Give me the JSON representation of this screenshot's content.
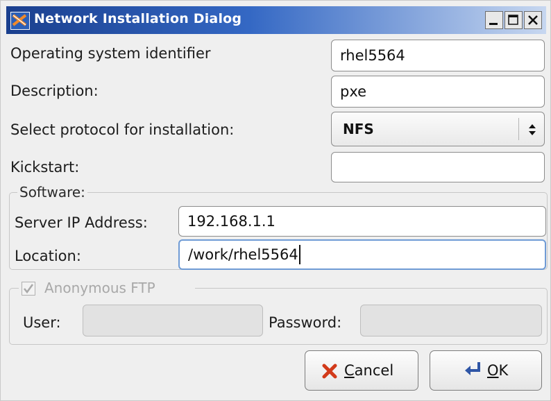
{
  "window": {
    "title": "Network Installation Dialog",
    "title_icon": "network-install-icon",
    "controls": [
      "minimize-icon",
      "maximize-icon",
      "close-icon"
    ]
  },
  "form": {
    "os_identifier": {
      "label": "Operating system identifier",
      "value": "rhel5564"
    },
    "description": {
      "label": "Description:",
      "value": "pxe"
    },
    "protocol": {
      "label": "Select protocol for installation:",
      "selected": "NFS"
    },
    "kickstart": {
      "label": "Kickstart:",
      "value": ""
    }
  },
  "software": {
    "legend": "Software:",
    "server_ip": {
      "label": "Server IP Address:",
      "value": "192.168.1.1"
    },
    "location": {
      "label": "Location:",
      "value": "/work/rhel5564"
    }
  },
  "anonymous_ftp": {
    "legend": "Anonymous FTP",
    "checked": true,
    "enabled": false,
    "user": {
      "label": "User:",
      "value": ""
    },
    "password": {
      "label": "Password:",
      "value": ""
    }
  },
  "buttons": {
    "cancel": {
      "mnemonic": "C",
      "rest": "ancel",
      "icon": "cancel-x-icon"
    },
    "ok": {
      "mnemonic": "O",
      "rest": "K",
      "icon": "ok-return-icon"
    }
  },
  "colors": {
    "titlebar_start": "#1a3f8e",
    "titlebar_end": "#c7d7f0",
    "focus_border": "#6f9bd5",
    "cancel_icon": "#d23a1a",
    "ok_icon": "#2f56a6"
  }
}
